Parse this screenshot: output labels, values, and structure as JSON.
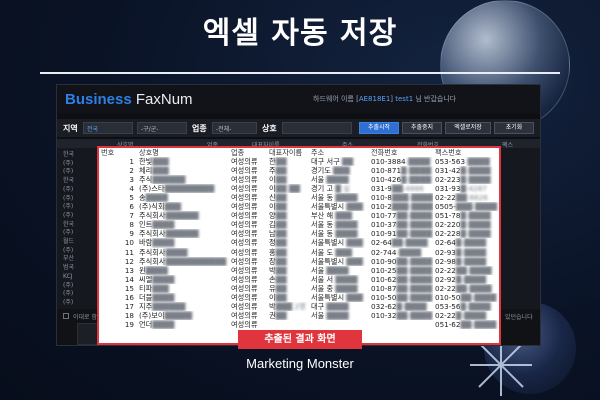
{
  "banner": {
    "title": "엑셀 자동 저장",
    "footer": "Marketing Monster",
    "caption": "추출된 결과 화면"
  },
  "app": {
    "logo_part1": "Business",
    "logo_part2": "FaxNum",
    "user_info_prefix": "하드웨어 이름 [",
    "user_info_hw": "AE818E1",
    "user_info_mid": "] ",
    "user_info_user": "test1",
    "user_info_suffix": " 님 반갑습니다",
    "toolbar": {
      "region_label": "지역",
      "region_value": "전국",
      "district_value": "-구/군-",
      "industry_label": "업종",
      "industry_value": "-전체-",
      "company_label": "상호",
      "start_button": "추출시작",
      "stop_button": "추출중지",
      "excel_button": "엑셀로저장",
      "reset_button": "초기화"
    },
    "bg_columns": [
      "상호명",
      "업종",
      "대표자이름",
      "주소",
      "전화번호",
      "팩스"
    ],
    "bg_rows": [
      "한국",
      "(주)",
      "(주)",
      "한국",
      "(주)",
      "(주)",
      "(주)",
      "(주)",
      "한국",
      "(주)",
      "월드",
      "(주)",
      "부산",
      "범국",
      "KCJ",
      "(주)",
      "(주)",
      "(주)"
    ],
    "bg_check_label": "이대로 함",
    "bg_right_label": "있던습니다"
  },
  "results": {
    "columns": [
      "번호",
      "상호명",
      "업종",
      "대표자이름",
      "주소",
      "전화번호",
      "팩스번호"
    ],
    "rows": [
      {
        "no": "1",
        "name_prefix": "",
        "name": "한빛",
        "name_blur": "███",
        "industry": "여성의류",
        "rep": "한",
        "rep_blur": "██",
        "addr": "대구 서구",
        "addr_blur": "██",
        "phone": "010-3884",
        "phone_blur": "-████",
        "fax": "053-563",
        "fax_blur": "-████"
      },
      {
        "no": "2",
        "name_prefix": "",
        "name": "체리",
        "name_blur": "███",
        "industry": "여성의류",
        "rep": "주",
        "rep_blur": "██",
        "addr": "경기도",
        "addr_blur": "███",
        "phone": "010-871",
        "phone_blur": "█-████",
        "fax": "031-42",
        "fax_blur": "█-████"
      },
      {
        "no": "3",
        "name_prefix": "",
        "name": "주식",
        "name_blur": "██████",
        "industry": "여성의류",
        "rep": "이",
        "rep_blur": "██",
        "addr": "서울",
        "addr_blur": "████",
        "phone": "010-426",
        "phone_blur": "█-████",
        "fax": "02-223",
        "fax_blur": "█-████"
      },
      {
        "no": "4",
        "name_prefix": "(주)",
        "name": "스타",
        "name_blur": "█████████",
        "industry": "여성의류",
        "rep": "이",
        "rep_blur": "██ ██",
        "addr": "경기 고",
        "addr_blur": "█ 실",
        "phone": "031-9",
        "phone_blur": "██-4886",
        "fax": "031-93",
        "fax_blur": "█-4287"
      },
      {
        "no": "5",
        "name_prefix": "",
        "name": "송",
        "name_blur": "████",
        "industry": "여성의류",
        "rep": "신",
        "rep_blur": "██",
        "addr": "서울 동",
        "addr_blur": "████",
        "phone": "010-8",
        "phone_blur": "███-████",
        "fax": "02-22",
        "fax_blur": "██-8626"
      },
      {
        "no": "6",
        "name_prefix": "(주)",
        "name": "식회",
        "name_blur": "███",
        "industry": "여성의류",
        "rep": "이",
        "rep_blur": "██",
        "addr": "서울특별시",
        "addr_blur": "███",
        "phone": "010-2",
        "phone_blur": "███-████",
        "fax": "0505-",
        "fax_blur": "███-████"
      },
      {
        "no": "7",
        "name_prefix": "",
        "name": "주식회사",
        "name_blur": "██████",
        "industry": "여성의류",
        "rep": "양",
        "rep_blur": "██",
        "addr": "부산 해",
        "addr_blur": "███",
        "phone": "010-77",
        "phone_blur": "██-████",
        "fax": "051-78",
        "fax_blur": "█-████"
      },
      {
        "no": "8",
        "name_prefix": "",
        "name": "인트",
        "name_blur": "████",
        "industry": "여성의류",
        "rep": "김",
        "rep_blur": "██",
        "addr": "서울 동",
        "addr_blur": "████",
        "phone": "010-37",
        "phone_blur": "██-████",
        "fax": "02-220",
        "fax_blur": "█-████"
      },
      {
        "no": "9",
        "name_prefix": "",
        "name": "주식회사",
        "name_blur": "██████",
        "industry": "여성의류",
        "rep": "남",
        "rep_blur": "██",
        "addr": "서울 동",
        "addr_blur": "████",
        "phone": "010-91",
        "phone_blur": "██-████",
        "fax": "02-228",
        "fax_blur": "█-████"
      },
      {
        "no": "10",
        "name_prefix": "",
        "name": "바람",
        "name_blur": "████",
        "industry": "여성의류",
        "rep": "정",
        "rep_blur": "██",
        "addr": "서울특별시",
        "addr_blur": "███",
        "phone": "02-64",
        "phone_blur": "██-████",
        "fax": "02-64",
        "fax_blur": "█-████"
      },
      {
        "no": "11",
        "name_prefix": "",
        "name": "주식회사",
        "name_blur": "████",
        "industry": "여성의류",
        "rep": "홍",
        "rep_blur": "██",
        "addr": "서울 도",
        "addr_blur": "███",
        "phone": "02-744",
        "phone_blur": "-████",
        "fax": "02-93",
        "fax_blur": "█-████"
      },
      {
        "no": "12",
        "name_prefix": "",
        "name": "주식회사",
        "name_blur": "███████████",
        "industry": "여성의류",
        "rep": "장",
        "rep_blur": "██",
        "addr": "서울특별시",
        "addr_blur": "███",
        "phone": "010-90",
        "phone_blur": "██-████",
        "fax": "02-98",
        "fax_blur": "█-████"
      },
      {
        "no": "13",
        "name_prefix": "",
        "name": "윈",
        "name_blur": "████",
        "industry": "여성의류",
        "rep": "박",
        "rep_blur": "██",
        "addr": "서울",
        "addr_blur": "████",
        "phone": "010-25",
        "phone_blur": "██-████",
        "fax": "02-22",
        "fax_blur": "██-████"
      },
      {
        "no": "14",
        "name_prefix": "",
        "name": "씨엘",
        "name_blur": "████",
        "industry": "여성의류",
        "rep": "손",
        "rep_blur": "██",
        "addr": "서울 서",
        "addr_blur": "████",
        "phone": "010-62",
        "phone_blur": "██-████",
        "fax": "02-92",
        "fax_blur": "█-████"
      },
      {
        "no": "15",
        "name_prefix": "",
        "name": "티파",
        "name_blur": "███",
        "industry": "여성의류",
        "rep": "유",
        "rep_blur": "██",
        "addr": "서울 중",
        "addr_blur": "████",
        "phone": "010-87",
        "phone_blur": "██-████",
        "fax": "02-22",
        "fax_blur": "██-████"
      },
      {
        "no": "16",
        "name_prefix": "",
        "name": "더블",
        "name_blur": "████",
        "industry": "여성의류",
        "rep": "이",
        "rep_blur": "██",
        "addr": "서울특별시",
        "addr_blur": "███",
        "phone": "010-50",
        "phone_blur": "██-████",
        "fax": "010-50",
        "fax_blur": "██-████"
      },
      {
        "no": "17",
        "name_prefix": "",
        "name": "지주",
        "name_blur": "██████",
        "industry": "여성의류",
        "rep": "박",
        "rep_blur": "███ 2명",
        "addr": "대구",
        "addr_blur": "████",
        "phone": "032-62",
        "phone_blur": "█-████",
        "fax": "053-56",
        "fax_blur": "█-████"
      },
      {
        "no": "18",
        "name_prefix": "(주)",
        "name": "보이",
        "name_blur": "█████",
        "industry": "여성의류",
        "rep": "권",
        "rep_blur": "██",
        "addr": "서울",
        "addr_blur": "████",
        "phone": "010-32",
        "phone_blur": "██-████",
        "fax": "02-22",
        "fax_blur": "█-████"
      },
      {
        "no": "19",
        "name_prefix": "",
        "name": "언더",
        "name_blur": "████",
        "industry": "여성의류",
        "rep": "",
        "rep_blur": "",
        "addr": "",
        "addr_blur": "",
        "phone": "",
        "phone_blur": "",
        "fax": "051-62",
        "fax_blur": "██-████"
      }
    ]
  },
  "colors": {
    "accent_red": "#e0353d",
    "logo_blue": "#2e7fe6",
    "button_blue": "#2f6fd1",
    "background": "#0a1326"
  }
}
